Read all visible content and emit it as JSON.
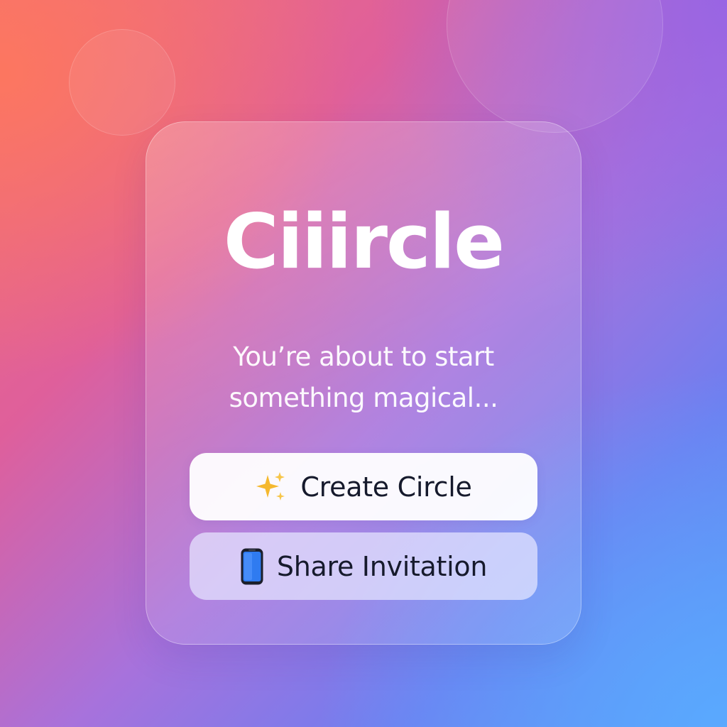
{
  "app": {
    "title": "Ciiircle",
    "tagline_line1": "You’re about to start",
    "tagline_line2": "something magical..."
  },
  "buttons": {
    "create": {
      "label": "Create Circle",
      "icon": "sparkles-icon"
    },
    "share": {
      "label": "Share Invitation",
      "icon": "mobile-phone-icon"
    }
  },
  "colors": {
    "background_start": "#f2707a",
    "background_mid": "#a772dc",
    "background_end": "#5a95f5",
    "text_primary": "#ffffff",
    "button_text": "#161a2c",
    "sparkle": "#f5b82e",
    "phone": "#2f7bf0"
  }
}
